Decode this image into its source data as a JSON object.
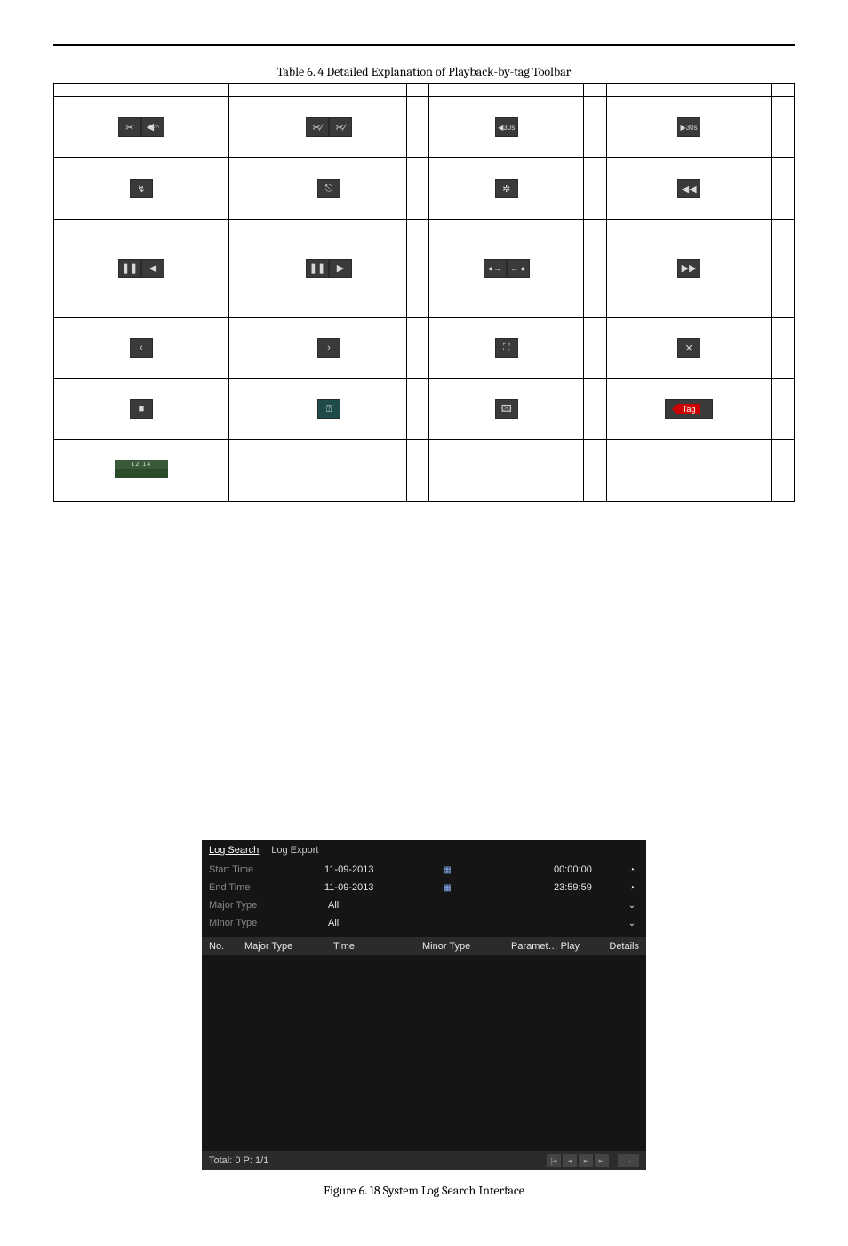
{
  "captions": {
    "table": "Table 6. 4 Detailed Explanation of Playback-by-tag Toolbar",
    "figure": "Figure 6. 18 System Log Search Interface"
  },
  "icons": {
    "r1c1a": "✂",
    "r1c1b": "◀𝄐",
    "r1c3a": "✂⁄",
    "r1c3b": "✂⁄",
    "r1c5": "◀30s",
    "r1c7": "▶30s",
    "r2c1": "↯",
    "r2c3": "⎋",
    "r2c5": "✲",
    "r2c7": "◀◀",
    "r3c1a": "❚❚",
    "r3c1b": "◀",
    "r3c3a": "❚❚",
    "r3c3b": "▶",
    "r3c5a": "●→",
    "r3c5b": "← ●",
    "r3c7": "▶▶",
    "r4c1": "‹",
    "r4c3": "›",
    "r4c5": "⛶",
    "r4c7": "✕",
    "r5c1": "■",
    "r5c3": "⍰",
    "r5c5": "🖾",
    "r5c7": "Tag"
  },
  "log": {
    "tabs": {
      "search": "Log Search",
      "export": "Log Export"
    },
    "start_label": "Start Time",
    "end_label": "End Time",
    "major_label": "Major Type",
    "minor_label": "Minor Type",
    "start_date": "11-09-2013",
    "end_date": "11-09-2013",
    "start_time": "00:00:00",
    "end_time": "23:59:59",
    "major_val": "All",
    "minor_val": "All",
    "cols": {
      "no": "No.",
      "major": "Major Type",
      "time": "Time",
      "minor": "Minor Type",
      "param": "Paramet… Play",
      "details": "Details"
    },
    "total": "Total: 0  P: 1/1"
  }
}
